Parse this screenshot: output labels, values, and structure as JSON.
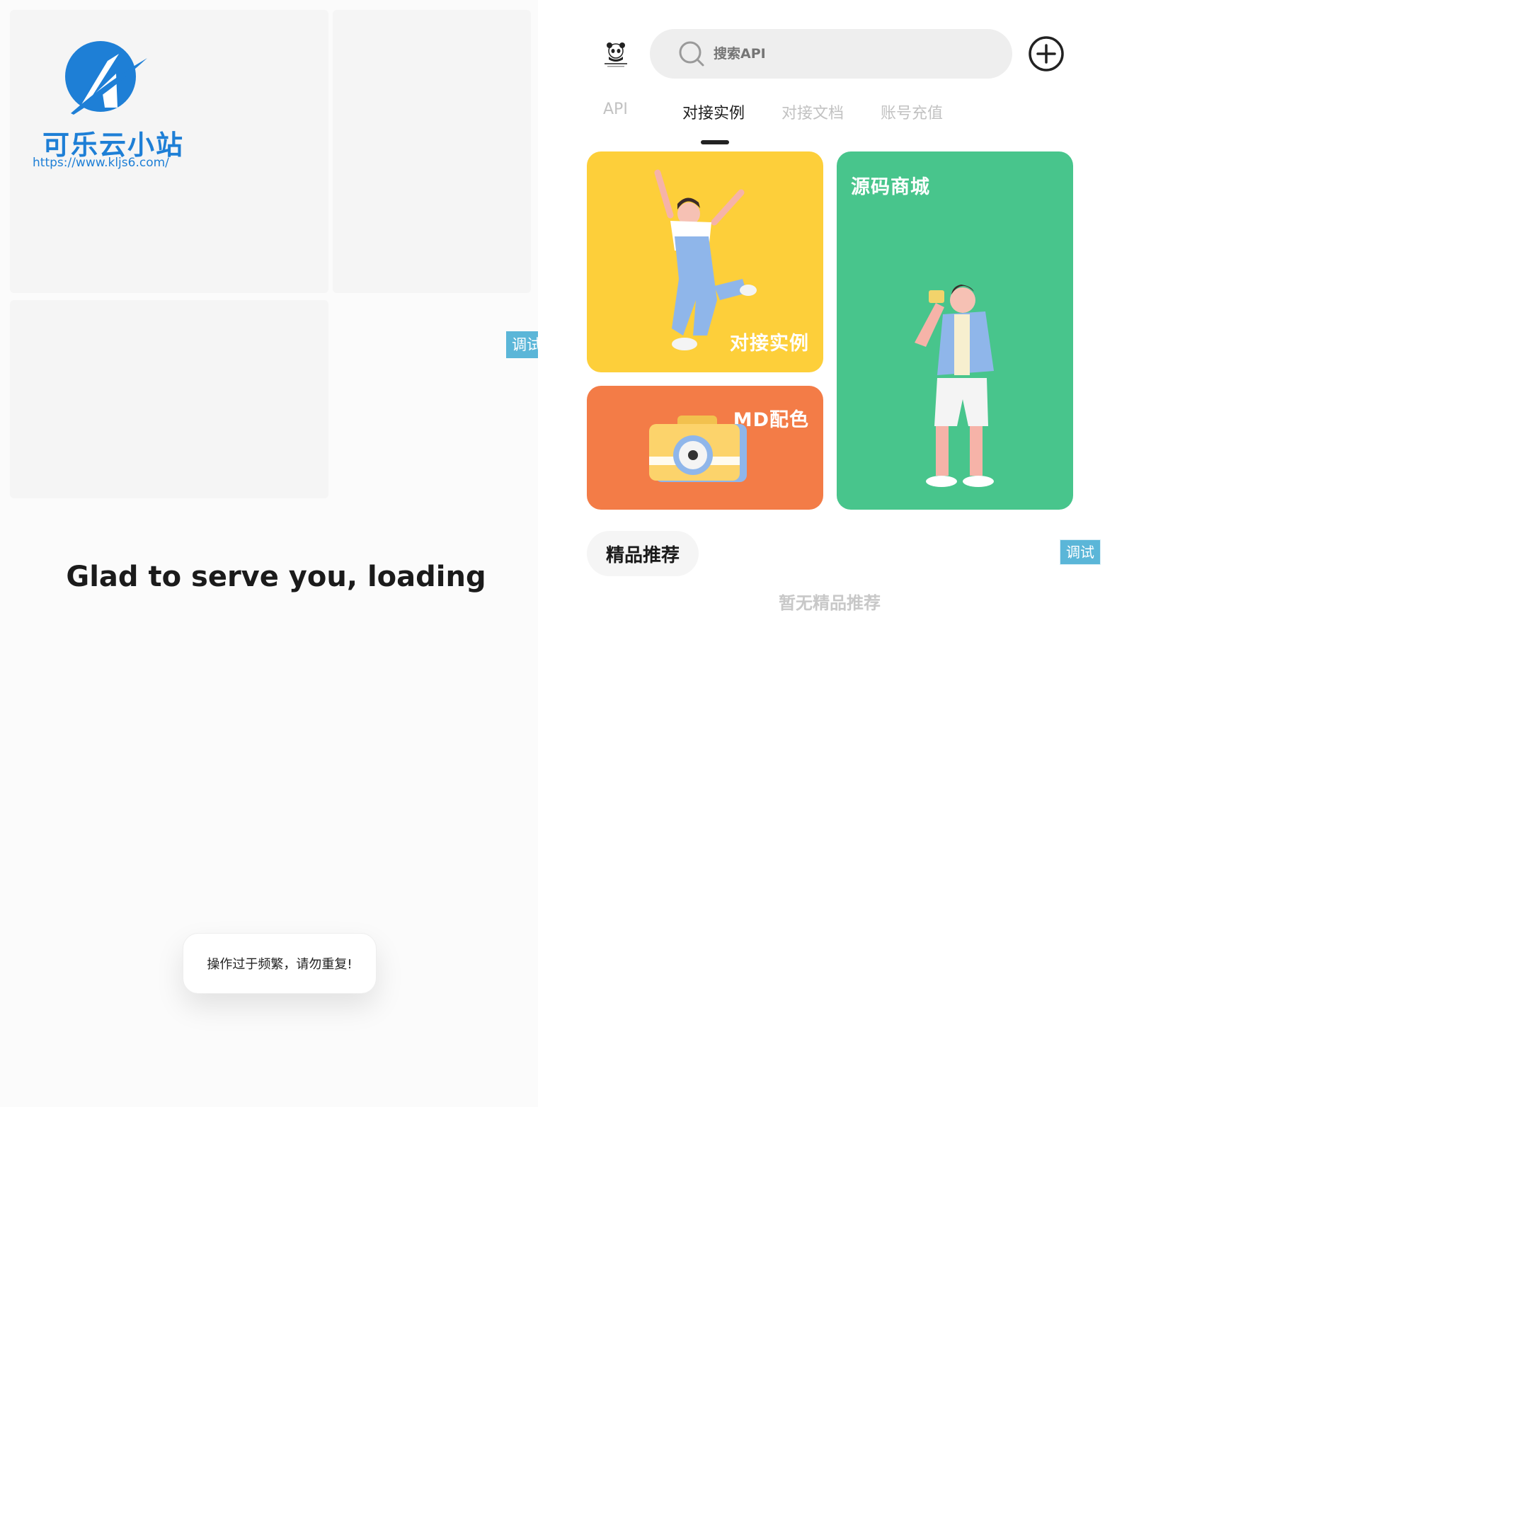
{
  "left_screen": {
    "brand": {
      "name": "可乐云小站",
      "url": "https://www.kljs6.com/"
    },
    "loading_text": "Glad to serve you, loading",
    "debug_button": "调试",
    "toast": "操作过于频繁，请勿重复!"
  },
  "right_screen": {
    "search": {
      "placeholder": "搜索API"
    },
    "tabs": [
      {
        "label": "API",
        "active": false
      },
      {
        "label": "对接实例",
        "active": true
      },
      {
        "label": "对接文档",
        "active": false
      },
      {
        "label": "账号充值",
        "active": false
      }
    ],
    "cards": {
      "examples": {
        "label": "对接实例",
        "color": "#fdcf3a"
      },
      "shop": {
        "label": "源码商城",
        "color": "#48c58c"
      },
      "md": {
        "label": "MD配色",
        "color": "#f37c47"
      }
    },
    "featured": {
      "title": "精品推荐",
      "empty": "暂无精品推荐"
    },
    "debug_button": "调试"
  },
  "icons": [
    "k-logo",
    "panda-logo-icon",
    "search-icon",
    "plus-circle-icon"
  ],
  "colors": {
    "brand_blue": "#1e7fd6",
    "debug": "#5bb6d8"
  }
}
